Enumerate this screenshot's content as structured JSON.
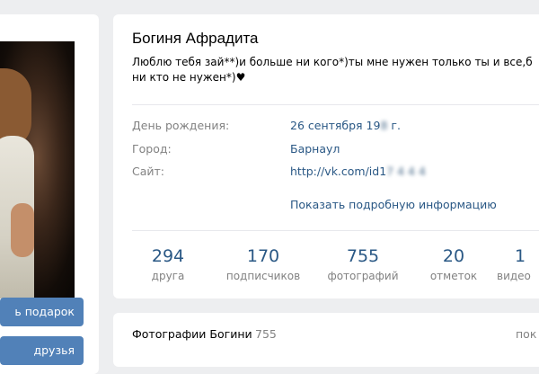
{
  "profile": {
    "name": "Богиня Афрадита",
    "status": "Люблю тебя зай**)и больше ни кого*)ты мне нужен только ты и все,б\nни кто не нужен*)♥"
  },
  "info": {
    "birthday_label": "День рождения:",
    "birthday_value_visible": "26 сентября 19",
    "birthday_value_blurred": "8",
    "birthday_suffix": " г.",
    "city_label": "Город:",
    "city_value": "Барнаул",
    "site_label": "Сайт:",
    "site_value_visible": "http://vk.com/id1",
    "site_value_blurred": "7  4 4 4",
    "more_link": "Показать подробную информацию"
  },
  "counters": [
    {
      "num": "294",
      "label": "друга"
    },
    {
      "num": "170",
      "label": "подписчиков"
    },
    {
      "num": "755",
      "label": "фотографий"
    },
    {
      "num": "20",
      "label": "отметок"
    },
    {
      "num": "1",
      "label": "видео"
    }
  ],
  "left": {
    "gift_button": "ь подарок",
    "friends_button": "друзья"
  },
  "photos": {
    "title": "Фотографии Богини",
    "count": "755",
    "right_link": "пок"
  }
}
